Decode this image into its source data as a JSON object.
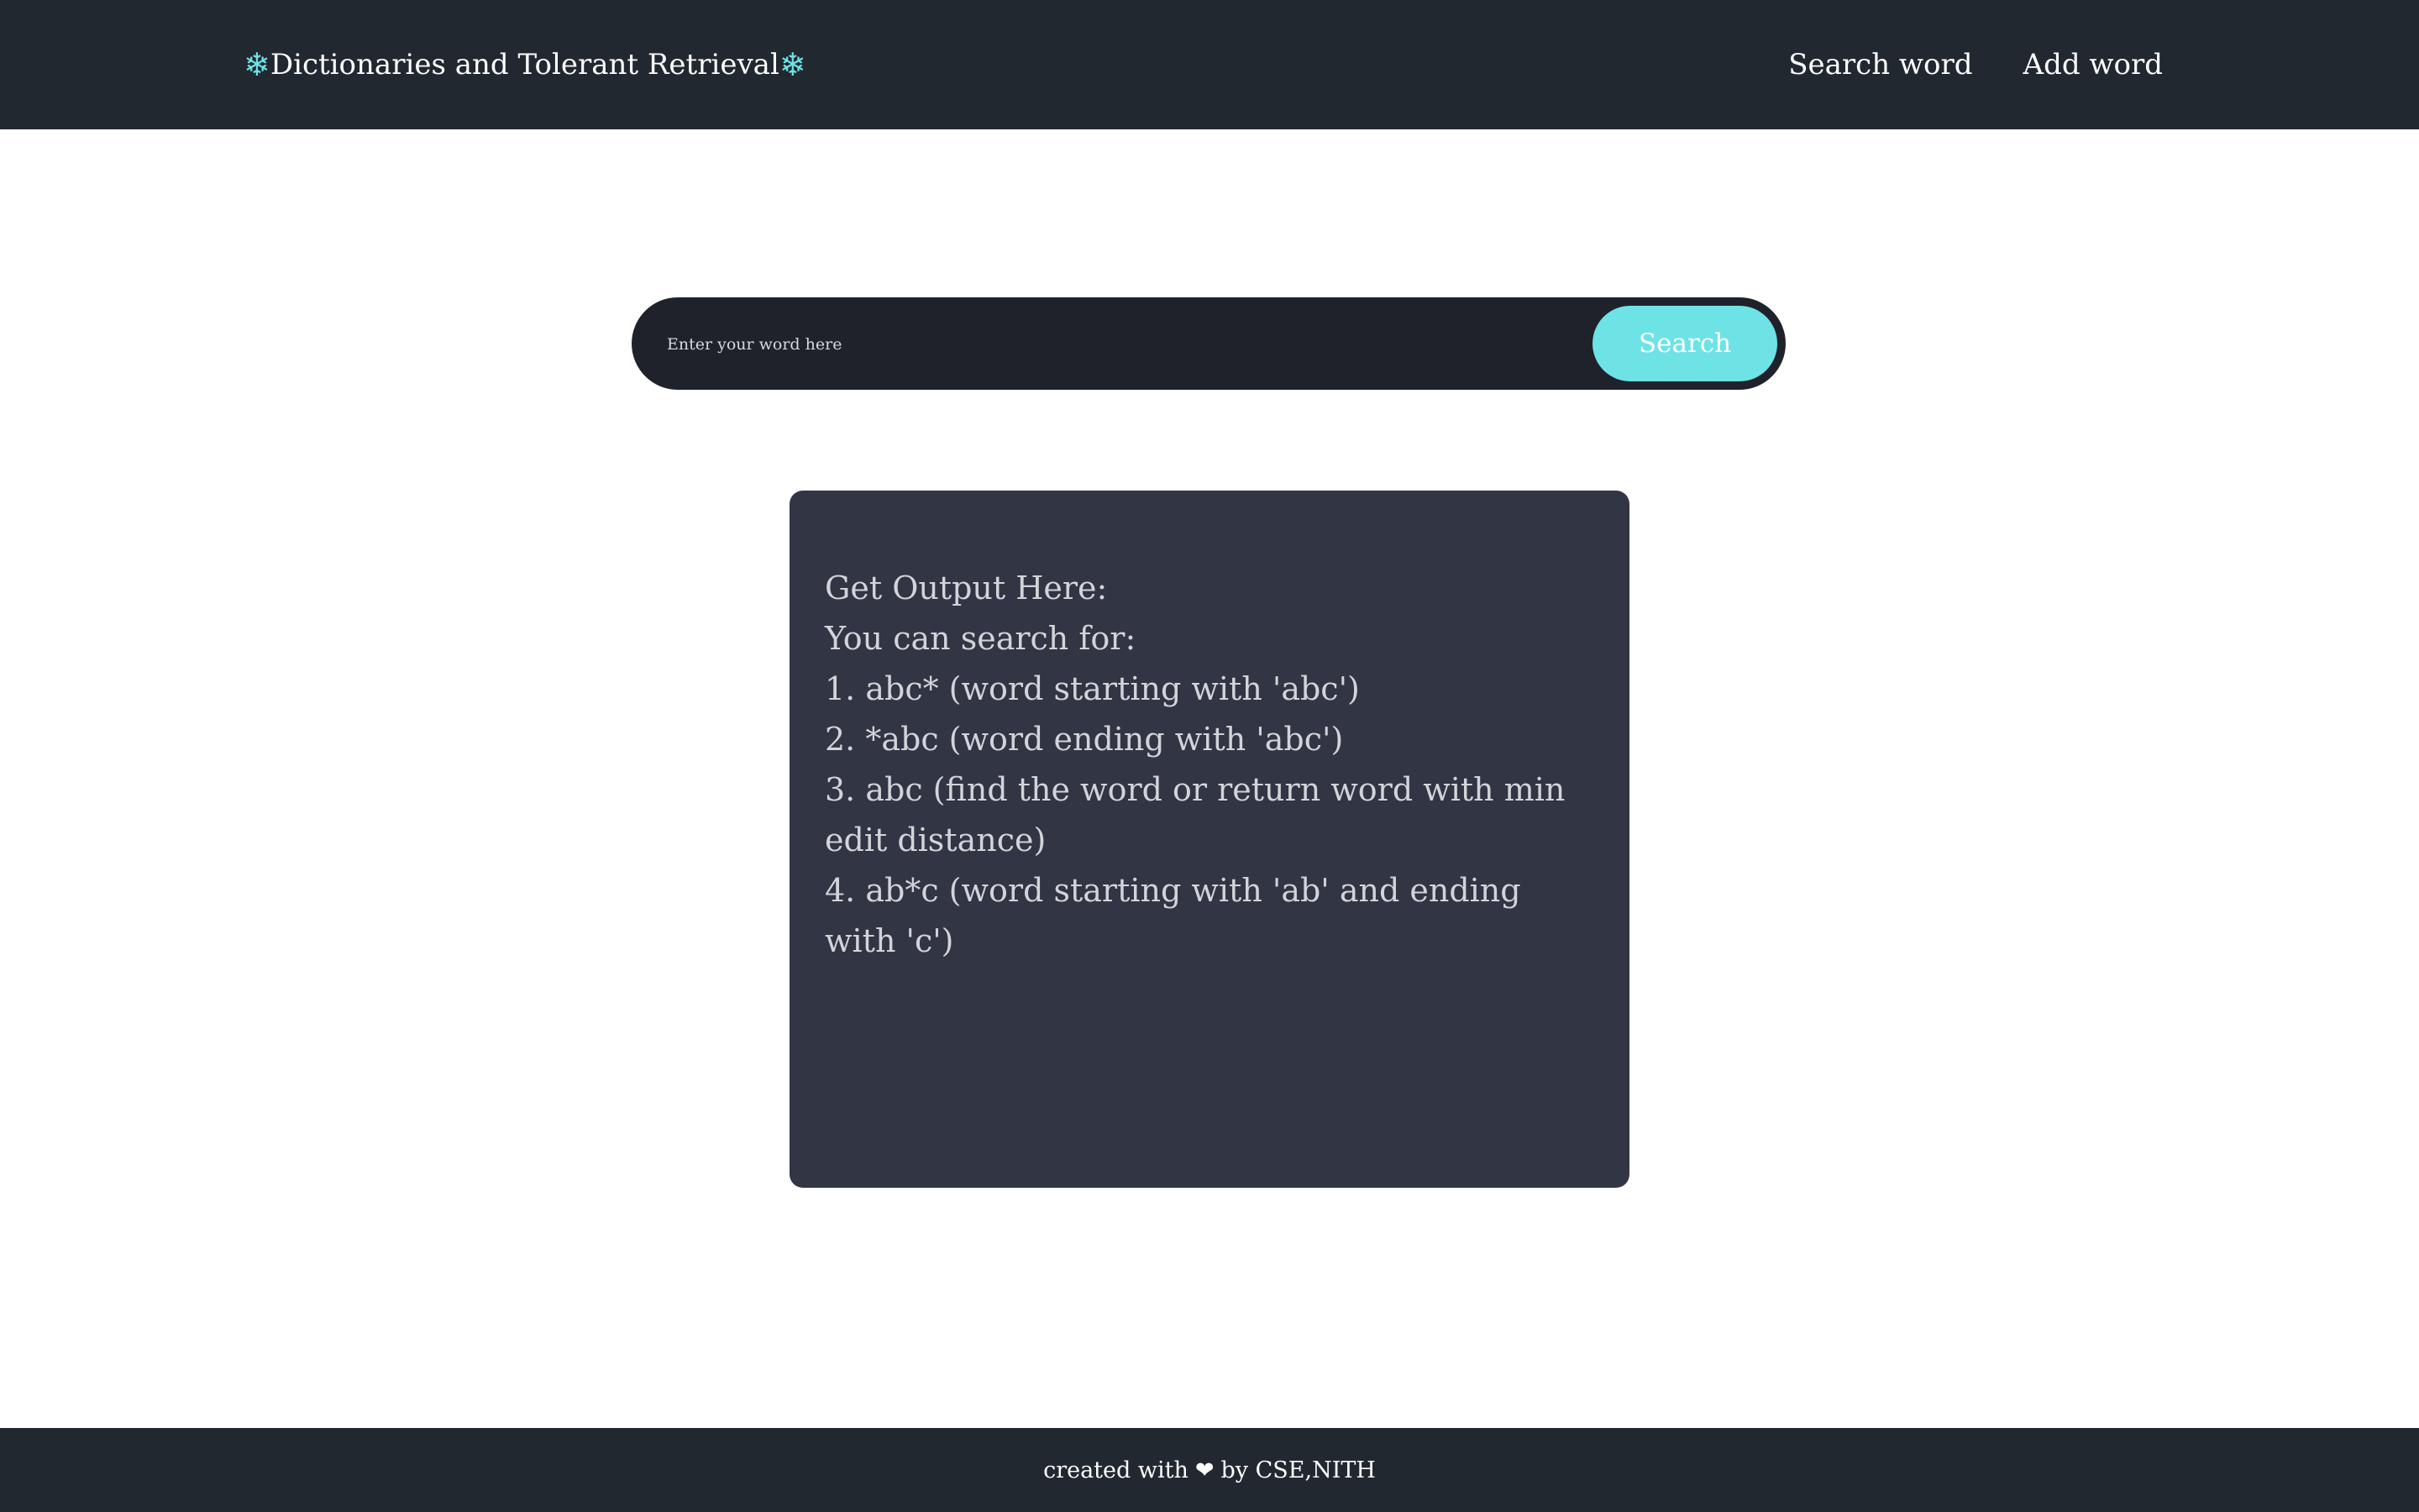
{
  "colors": {
    "navbar_bg": "#212830",
    "accent": "#6de3e6",
    "search_bar_bg": "#1f222b",
    "output_panel_bg": "#323544",
    "output_text": "#d2d4d9",
    "page_bg": "#ffffff"
  },
  "navbar": {
    "brand": {
      "icon_left": "❄",
      "title": "Dictionaries and Tolerant Retrieval",
      "icon_right": "❄",
      "icon_name": "snowflake-icon"
    },
    "links": [
      {
        "label": "Search word"
      },
      {
        "label": "Add word"
      }
    ]
  },
  "search": {
    "placeholder": "Enter your word here",
    "value": "",
    "button_label": "Search"
  },
  "output": {
    "lines": [
      "Get Output Here:",
      "You can search for:",
      "1. abc* (word starting with 'abc')",
      "2. *abc (word ending with 'abc')",
      "3. abc (find the word or return word with min edit distance)",
      "4. ab*c (word starting with 'ab' and ending with 'c')"
    ]
  },
  "footer": {
    "text_before": "created with",
    "heart": "❤",
    "heart_icon_name": "heart-icon",
    "text_after": "by CSE,NITH"
  }
}
